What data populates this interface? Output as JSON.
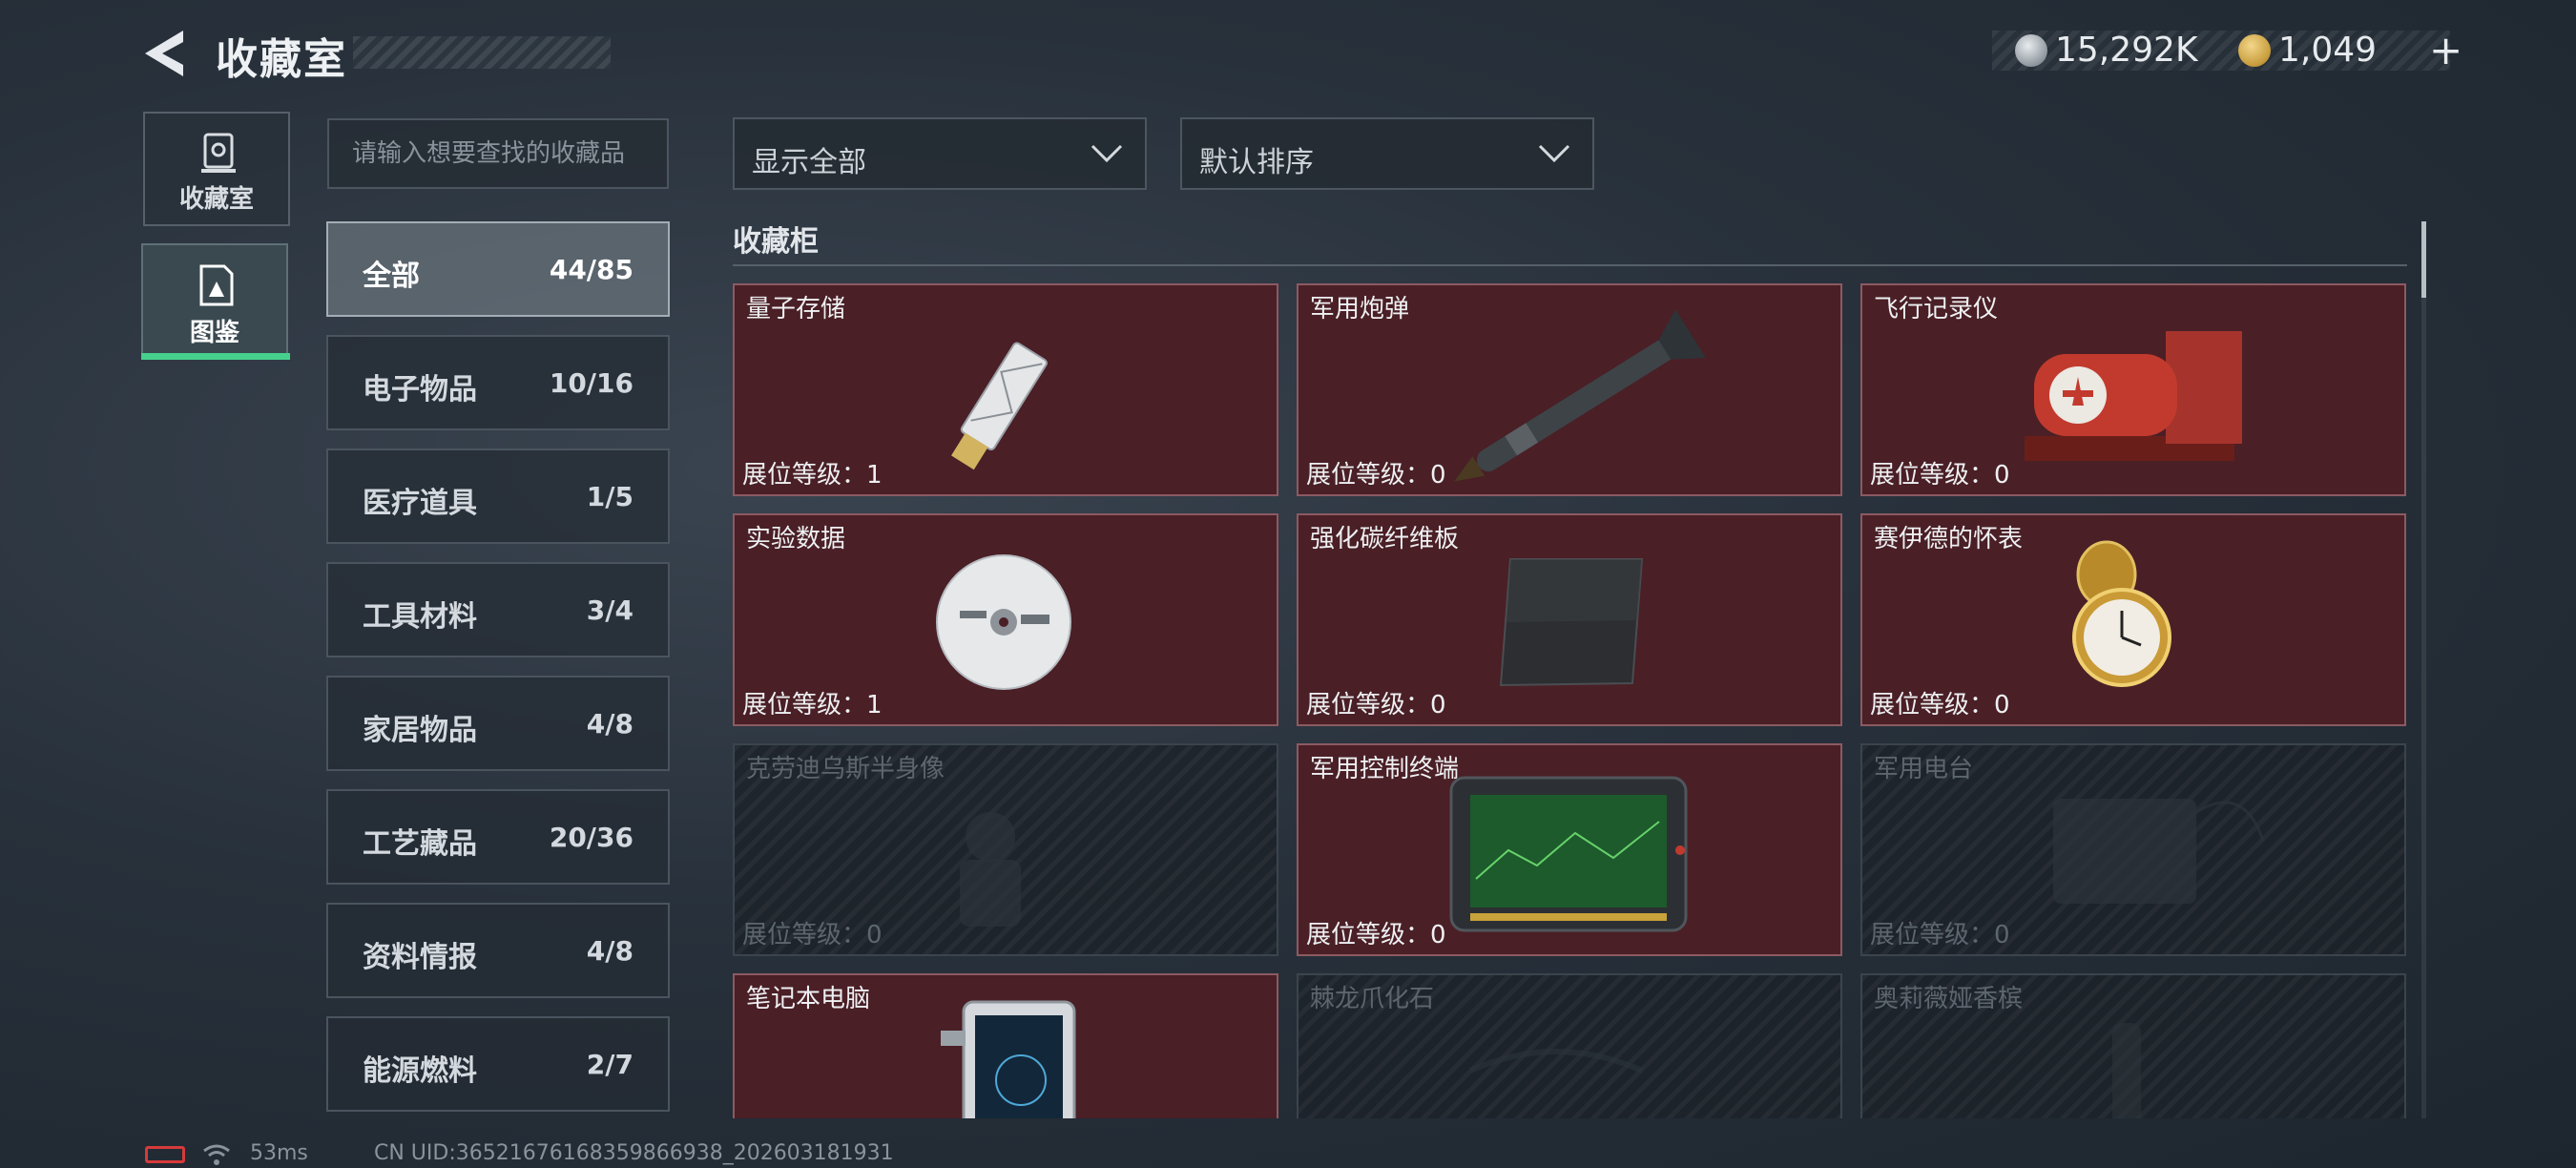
{
  "header": {
    "title": "收藏室",
    "currency": [
      {
        "icon": "silver-coin-icon",
        "value": "15,292K"
      },
      {
        "icon": "gold-coin-icon",
        "value": "1,049"
      }
    ],
    "add_label": "+"
  },
  "left_nav": [
    {
      "label": "收藏室",
      "icon": "display-case-icon",
      "active": false
    },
    {
      "label": "图鉴",
      "icon": "album-icon",
      "active": true
    }
  ],
  "search": {
    "placeholder": "请输入想要查找的收藏品"
  },
  "categories": [
    {
      "label": "全部",
      "count": "44/85",
      "active": true
    },
    {
      "label": "电子物品",
      "count": "10/16"
    },
    {
      "label": "医疗道具",
      "count": "1/5"
    },
    {
      "label": "工具材料",
      "count": "3/4"
    },
    {
      "label": "家居物品",
      "count": "4/8"
    },
    {
      "label": "工艺藏品",
      "count": "20/36"
    },
    {
      "label": "资料情报",
      "count": "4/8"
    },
    {
      "label": "能源燃料",
      "count": "2/7"
    }
  ],
  "filters": {
    "display": "显示全部",
    "sort": "默认排序"
  },
  "section": {
    "title": "收藏柜"
  },
  "items": [
    {
      "name": "量子存储",
      "level": "展位等级：1",
      "owned": true,
      "icon": "usb-drive-icon"
    },
    {
      "name": "军用炮弹",
      "level": "展位等级：0",
      "owned": true,
      "icon": "missile-icon"
    },
    {
      "name": "飞行记录仪",
      "level": "展位等级：0",
      "owned": true,
      "icon": "flight-recorder-icon"
    },
    {
      "name": "实验数据",
      "level": "展位等级：1",
      "owned": true,
      "icon": "disc-icon"
    },
    {
      "name": "强化碳纤维板",
      "level": "展位等级：0",
      "owned": true,
      "icon": "carbon-plate-icon"
    },
    {
      "name": "赛伊德的怀表",
      "level": "展位等级：0",
      "owned": true,
      "icon": "pocket-watch-icon"
    },
    {
      "name": "克劳迪乌斯半身像",
      "level": "展位等级：0",
      "owned": false,
      "icon": "bust-icon"
    },
    {
      "name": "军用控制终端",
      "level": "展位等级：0",
      "owned": true,
      "icon": "control-terminal-icon"
    },
    {
      "name": "军用电台",
      "level": "展位等级：0",
      "owned": false,
      "icon": "radio-icon"
    },
    {
      "name": "笔记本电脑",
      "level": "",
      "owned": true,
      "icon": "laptop-icon"
    },
    {
      "name": "棘龙爪化石",
      "level": "",
      "owned": false,
      "icon": "fossil-icon"
    },
    {
      "name": "奥莉薇娅香槟",
      "level": "",
      "owned": false,
      "icon": "champagne-icon"
    }
  ],
  "status_bar": {
    "ping": "53ms",
    "uid": "CN UID:3652167616835986693​8_202603181931"
  }
}
